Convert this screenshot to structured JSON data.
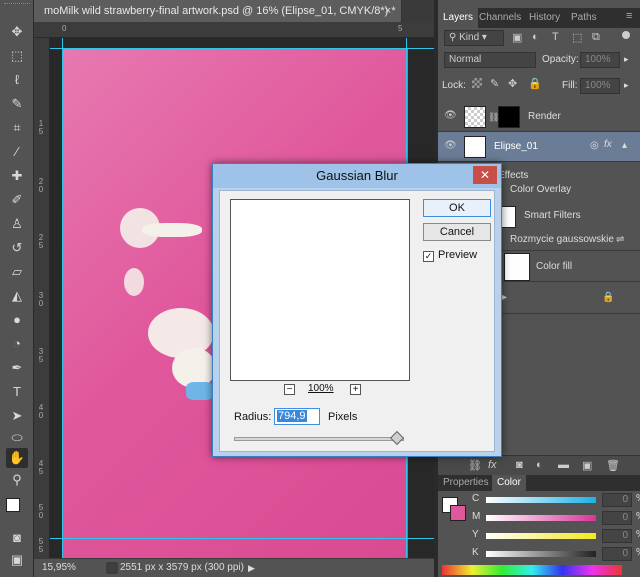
{
  "document": {
    "tab_title": "moMilk wild strawberry-final artwork.psd @ 16% (Elipse_01, CMYK/8*) *",
    "close_glyph": "×"
  },
  "rulers": {
    "h_labels": [
      "0",
      "5"
    ],
    "v_labels": [
      "1 5",
      "2 0",
      "2 5",
      "3 0",
      "3 5",
      "4 0",
      "4 5",
      "5 0",
      "5 5"
    ]
  },
  "status": {
    "zoom": "15,95%",
    "doc_info": "2551 px x 3579 px (300 ppi)"
  },
  "tools": [
    "move-tool",
    "marquee-tool",
    "lasso-tool",
    "quick-select-tool",
    "crop-tool",
    "eyedropper-tool",
    "healing-tool",
    "brush-tool",
    "stamp-tool",
    "history-brush-tool",
    "eraser-tool",
    "gradient-tool",
    "blur-tool",
    "dodge-tool",
    "pen-tool",
    "type-tool",
    "path-select-tool",
    "shape-tool",
    "hand-tool",
    "zoom-tool"
  ],
  "layers_panel": {
    "tabs": [
      "Layers",
      "Channels",
      "History",
      "Paths"
    ],
    "kind_label": "Kind",
    "blend_mode": "Normal",
    "opacity_label": "Opacity:",
    "opacity_value": "100%",
    "lock_label": "Lock:",
    "fill_label": "Fill:",
    "fill_value": "100%",
    "layers": [
      {
        "name": "Render"
      },
      {
        "name": "Elipse_01"
      }
    ],
    "sub_items": [
      "Effects",
      "Color Overlay",
      "Smart Filters",
      "Rozmycie gaussowskie",
      "Color fill"
    ]
  },
  "color_panel": {
    "tabs": [
      "Properties",
      "Color"
    ],
    "channels": [
      {
        "label": "C",
        "value": "0",
        "unit": "%",
        "gradient": "#1ab2e6"
      },
      {
        "label": "M",
        "value": "0",
        "unit": "%",
        "gradient": "#d9359a"
      },
      {
        "label": "Y",
        "value": "0",
        "unit": "%",
        "gradient": "#f2e81e"
      },
      {
        "label": "K",
        "value": "0",
        "unit": "%",
        "gradient": "#222222"
      }
    ],
    "foreground": "#ffffff",
    "background": "#e0589c"
  },
  "dialog": {
    "title": "Gaussian Blur",
    "close_glyph": "✕",
    "ok_label": "OK",
    "cancel_label": "Cancel",
    "preview_label": "Preview",
    "preview_checked": true,
    "zoom_minus": "−",
    "zoom_value": "100%",
    "zoom_plus": "+",
    "radius_label": "Radius:",
    "radius_value": "794,9",
    "radius_unit": "Pixels"
  }
}
